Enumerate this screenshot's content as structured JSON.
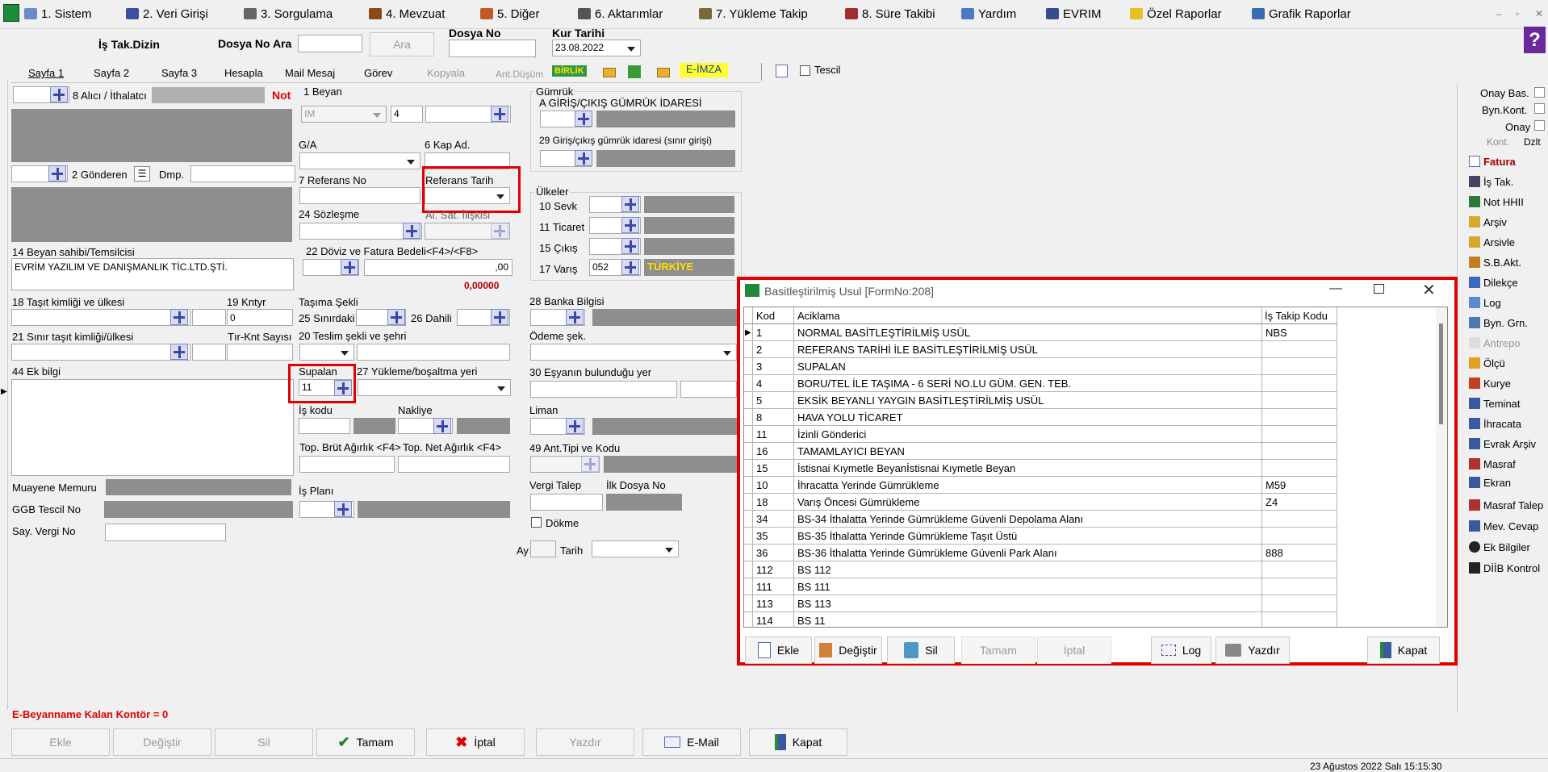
{
  "menu": [
    "1.  Sistem",
    "2.  Veri Girişi",
    "3.  Sorgulama",
    "4.  Mevzuat",
    "5.  Diğer",
    "6.  Aktarımlar",
    "7.  Yükleme Takip",
    "8. Süre Takibi",
    "Yardım",
    "EVRIM",
    "Özel Raporlar",
    "Grafik Raporlar"
  ],
  "header": {
    "is_tak_dizin": "İş Tak.Dizin",
    "dosya_no_ara": "Dosya No Ara",
    "ara_button": "Ara",
    "dosya_no": "Dosya No",
    "kur_tarihi": "Kur Tarihi",
    "kur_tarihi_value": "23.08.2022"
  },
  "tabs": [
    "Sayfa 1",
    "Sayfa 2",
    "Sayfa 3",
    "Hesapla",
    "Mail Mesaj",
    "Görev",
    "Kopyala",
    "Ant.Düşüm"
  ],
  "toolbar": {
    "birlik": "BİRLİK",
    "eimza": "E-İMZA",
    "tescil": "Tescil"
  },
  "form": {
    "alici": "8 Alıcı / İthalatcı",
    "not": "Not",
    "beyan": "1 Beyan",
    "beyan_type": "IM",
    "beyan_no": "4",
    "gumruk": "Gümrük",
    "giris_cikis": "A GİRİŞ/ÇIKIŞ GÜMRÜK İDARESİ",
    "giris_cikis_sinir": "29 Giriş/çıkış gümrük idaresi (sınır girişi)",
    "ga": "G/A",
    "kap_ad": "6 Kap Ad.",
    "gonderen": "2 Gönderen",
    "dmp": "Dmp.",
    "referans_no": "7 Referans No",
    "referans_tarih": "Referans Tarih",
    "ulkeler": "Ülkeler",
    "sevk": "10 Sevk",
    "ticaret": "11 Ticaret",
    "cikis": "15 Çıkış",
    "varis": "17 Varış",
    "varis_code": "052",
    "varis_name": "TÜRKİYE",
    "sozlesme": "24 Sözleşme",
    "al_sat": "Al. Sat. İlişkisi",
    "beyan_sahibi": "14 Beyan sahibi/Temsilcisi",
    "beyan_sahibi_value": "EVRİM YAZILIM VE DANIŞMANLIK TİC.LTD.ŞTİ.",
    "doviz": "22 Döviz ve Fatura Bedeli<F4>/<F8>",
    "doviz_value": ",00",
    "doviz_red": "0,00000",
    "tasit": "18 Taşıt kimliği ve ülkesi",
    "kntyr": "19 Kntyr",
    "kntyr_value": "0",
    "tasima": "Taşıma Şekli",
    "sinirdaki": "25 Sınırdaki",
    "dahili": "26 Dahili",
    "banka": "28 Banka Bilgisi",
    "sinir_tasit": "21 Sınır taşıt kimliği/ülkesi",
    "tir_knt": "Tır-Knt Sayısı",
    "teslim": "20 Teslim şekli ve şehri",
    "odeme": "Ödeme şek.",
    "ek_bilgi": "44 Ek bilgi",
    "supalan": "Supalan",
    "supalan_value": "11",
    "yukleme": "27 Yükleme/boşaltma yeri",
    "esya_yer": "30 Eşyanın bulunduğu yer",
    "is_kodu": "İş kodu",
    "nakliye": "Nakliye",
    "liman": "Liman",
    "brut": "Top. Brüt Ağırlık <F4>",
    "net": "Top. Net Ağırlık <F4>",
    "ant_tipi": "49 Ant.Tipi ve Kodu",
    "muayene": "Muayene Memuru",
    "is_plani": "İş Planı",
    "vergi_talep": "Vergi Talep",
    "ilk_dosya": "İlk Dosya No",
    "ggb": "GGB Tescil No",
    "dokme": "Dökme",
    "say_vergi": "Say. Vergi No",
    "ay": "Ay",
    "tarih": "Tarih",
    "kontor": "E-Beyanname Kalan Kontör = 0"
  },
  "right_panel": {
    "onay_bas": "Onay Bas.",
    "byn_kont": "Byn.Kont.",
    "onay": "Onay",
    "kont": "Kont.",
    "dzlt": "Dzlt",
    "items": [
      "Fatura",
      "İş Tak.",
      "Not HHII",
      "Arşiv",
      "Arsivle",
      "S.B.Akt.",
      "Dilekçe",
      "Log",
      "Byn. Grn.",
      "Antrepo",
      "Ölçü",
      "Kurye",
      "Teminat",
      "İhracata",
      "Evrak Arşiv",
      "Masraf",
      "Ekran",
      "Masraf Talep",
      "Mev. Cevap",
      "Ek Bilgiler",
      "DİİB Kontrol"
    ]
  },
  "dialog": {
    "title": "Basitleştirilmiş Usul [FormNo:208]",
    "columns": [
      "Kod",
      "Aciklama",
      "İş Takip Kodu"
    ],
    "rows": [
      [
        "1",
        "NORMAL BASİTLEŞTİRİLMİŞ USÜL",
        "NBS"
      ],
      [
        "2",
        "REFERANS TARİHİ İLE BASİTLEŞTİRİLMİŞ USÜL",
        ""
      ],
      [
        "3",
        "SUPALAN",
        ""
      ],
      [
        "4",
        "BORU/TEL İLE TAŞIMA - 6 SERİ NO.LU GÜM. GEN. TEB.",
        ""
      ],
      [
        "5",
        "EKSİK BEYANLI YAYGIN BASİTLEŞTİRİLMİŞ USÜL",
        ""
      ],
      [
        "8",
        "HAVA YOLU TİCARET",
        ""
      ],
      [
        "11",
        "İzinli Gönderici",
        ""
      ],
      [
        "16",
        "TAMAMLAYICI BEYAN",
        ""
      ],
      [
        "15",
        "İstisnai Kıymetle Beyanİstisnai Kıymetle Beyan",
        ""
      ],
      [
        "10",
        "İhracatta Yerinde Gümrükleme",
        "M59"
      ],
      [
        "18",
        "Varış Öncesi Gümrükleme",
        "Z4"
      ],
      [
        "34",
        "BS-34 İthalatta Yerinde Gümrükleme Güvenli Depolama Alanı",
        ""
      ],
      [
        "35",
        "BS-35 İthalatta Yerinde Gümrükleme Taşıt Üstü",
        ""
      ],
      [
        "36",
        "BS-36 İthalatta Yerinde Gümrükleme Güvenli Park Alanı",
        "888"
      ],
      [
        "112",
        "BS 112",
        ""
      ],
      [
        "111",
        "BS 111",
        ""
      ],
      [
        "113",
        "BS 113",
        ""
      ],
      [
        "114",
        "BS 11",
        ""
      ]
    ],
    "buttons": {
      "ekle": "Ekle",
      "degistir": "Değiştir",
      "sil": "Sil",
      "tamam": "Tamam",
      "iptal": "İptal",
      "log": "Log",
      "yazdir": "Yazdır",
      "kapat": "Kapat"
    }
  },
  "bottom_buttons": {
    "ekle": "Ekle",
    "degistir": "Değiştir",
    "sil": "Sil",
    "tamam": "Tamam",
    "iptal": "İptal",
    "yazdir": "Yazdır",
    "email": "E-Mail",
    "kapat": "Kapat"
  },
  "status_bar": "23 Ağustos 2022 Salı 15:15:30"
}
